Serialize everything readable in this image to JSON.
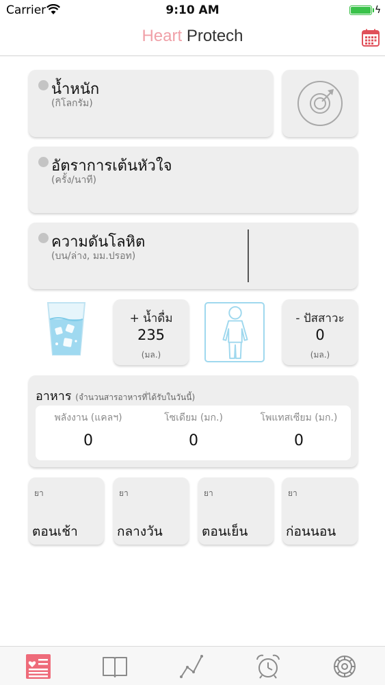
{
  "status_bar": {
    "carrier": "Carrier",
    "time": "9:10 AM"
  },
  "header": {
    "title_part1": "Heart",
    "title_part2": "Protech"
  },
  "vitals": {
    "weight": {
      "title": "น้ำหนัก",
      "unit": "(กิโลกรัม)"
    },
    "heart_rate": {
      "title": "อัตราการเต้นหัวใจ",
      "unit": "(ครั้ง/นาที)"
    },
    "blood_pressure": {
      "title": "ความดันโลหิต",
      "unit": "(บน/ล่าง, มม.ปรอท)"
    }
  },
  "water": {
    "drink_label": "+ น้ำดื่ม",
    "drink_value": "235",
    "drink_unit": "(มล.)",
    "urine_label": "- ปัสสาวะ",
    "urine_value": "0",
    "urine_unit": "(มล.)"
  },
  "food": {
    "title": "อาหาร",
    "subtitle": "(จำนวนสารอาหารที่ได้รับในวันนี้)",
    "columns": [
      {
        "label": "พลังงาน (แคลฯ)",
        "value": "0"
      },
      {
        "label": "โซเดียม (มก.)",
        "value": "0"
      },
      {
        "label": "โพแทสเซียม (มก.)",
        "value": "0"
      }
    ]
  },
  "meds": [
    {
      "small": "ยา",
      "label": "ตอนเช้า"
    },
    {
      "small": "ยา",
      "label": "กลางวัน"
    },
    {
      "small": "ยา",
      "label": "ตอนเย็น"
    },
    {
      "small": "ยา",
      "label": "ก่อนนอน"
    }
  ],
  "colors": {
    "brand_pink": "#f0a0a8",
    "calendar_red": "#e0505a",
    "tab_active": "#ee6b7a",
    "tab_inactive": "#8a8a8a",
    "person_outline": "#9fd8ee"
  },
  "icons": {
    "calendar": "calendar-icon",
    "target": "target-icon",
    "water_glass": "water-glass-icon",
    "person": "person-icon",
    "tabs": [
      "heart-list-icon",
      "book-icon",
      "graph-icon",
      "alarm-clock-icon",
      "settings-icon"
    ]
  }
}
